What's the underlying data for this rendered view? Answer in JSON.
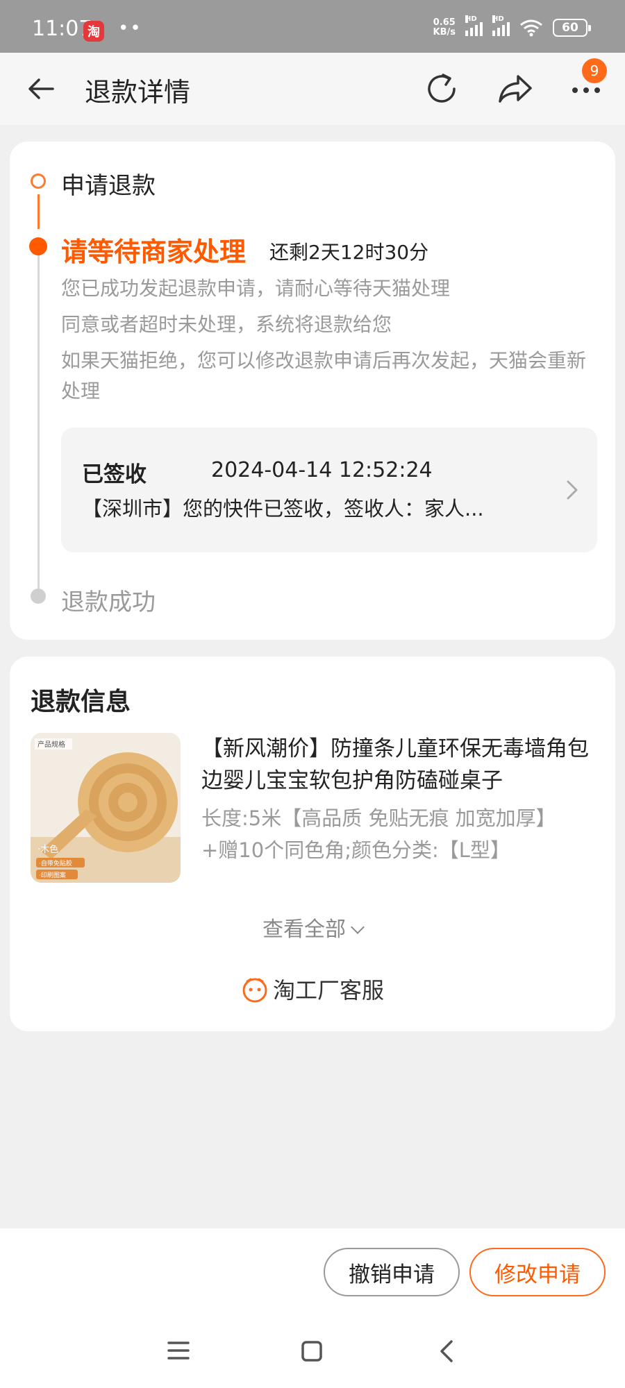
{
  "status_bar": {
    "time": "11:07",
    "app_icon_text": "淘",
    "dots": "••",
    "net_speed_value": "0.65",
    "net_speed_unit": "KB/s",
    "hd1": "HD",
    "hd2": "HD",
    "battery": "60"
  },
  "header": {
    "title": "退款详情",
    "badge_count": "9",
    "icons": [
      "back-arrow-icon",
      "refresh-icon",
      "share-icon",
      "more-icon"
    ]
  },
  "timeline": {
    "step1": "申请退款",
    "step2_title": "请等待商家处理",
    "step2_remaining": "还剩2天12时30分",
    "desc1": "您已成功发起退款申请，请耐心等待天猫处理",
    "desc2": "同意或者超时未处理，系统将退款给您",
    "desc3": "如果天猫拒绝，您可以修改退款申请后再次发起，天猫会重新处理",
    "logistics": {
      "status": "已签收",
      "time": "2024-04-14 12:52:24",
      "text": "【深圳市】您的快件已签收，签收人：家人..."
    },
    "step3": "退款成功"
  },
  "refund_info": {
    "title": "退款信息",
    "product_title": "【新风潮价】防撞条儿童环保无毒墙角包边婴儿宝宝软包护角防磕碰桌子",
    "product_spec": "长度:5米【高品质  免贴无痕  加宽加厚】+赠10个同色角;颜色分类:【L型】",
    "thumb_label_top": "产品规格",
    "thumb_label_color": "·木色",
    "thumb_tag1": "·自带免贴胶",
    "thumb_tag2": "·印刷图案",
    "view_all": "查看全部",
    "service": "淘工厂客服"
  },
  "actions": {
    "cancel": "撤销申请",
    "modify": "修改申请"
  },
  "colors": {
    "accent": "#ff5a00",
    "accent_light": "#ff7a2e",
    "muted_text": "#9a9a9a"
  }
}
